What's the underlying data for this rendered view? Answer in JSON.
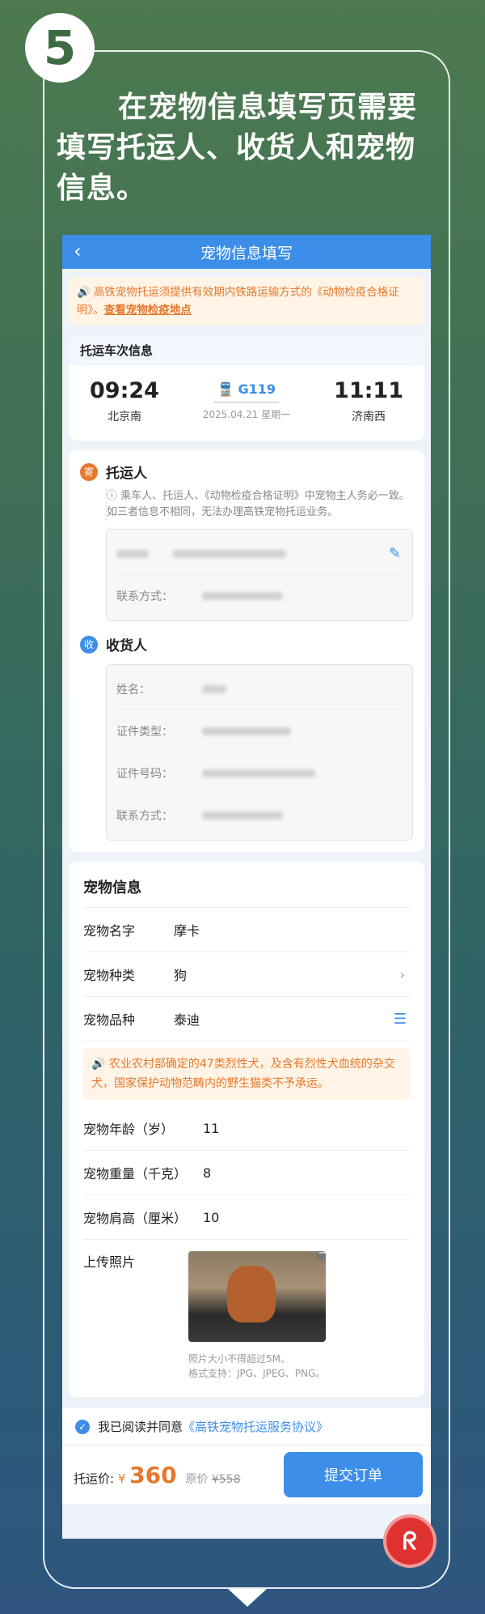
{
  "step": {
    "number": "5"
  },
  "headline": "在宠物信息填写页需要填写托运人、收货人和宠物信息。",
  "navbar": {
    "title": "宠物信息填写",
    "back_icon": "chevron-left-icon"
  },
  "notice": {
    "text": "高铁宠物托运须提供有效期内铁路运输方式的《动物检疫合格证明》。",
    "link": "查看宠物检疫地点"
  },
  "train": {
    "section_title": "托运车次信息",
    "depart_time": "09:24",
    "depart_station": "北京南",
    "train_no": "G119",
    "date": "2025.04.21 星期一",
    "arrive_time": "11:11",
    "arrive_station": "济南西"
  },
  "shipper": {
    "badge": "寄",
    "title": "托运人",
    "hint": "乘车人、托运人、《动物检疫合格证明》中宠物主人务必一致。如三者信息不相同，无法办理高铁宠物托运业务。",
    "contact_label": "联系方式："
  },
  "receiver": {
    "badge": "收",
    "title": "收货人",
    "rows": [
      {
        "label": "姓名："
      },
      {
        "label": "证件类型："
      },
      {
        "label": "证件号码："
      },
      {
        "label": "联系方式："
      }
    ]
  },
  "pet": {
    "title": "宠物信息",
    "name_label": "宠物名字",
    "name_value": "摩卡",
    "kind_label": "宠物种类",
    "kind_value": "狗",
    "breed_label": "宠物品种",
    "breed_value": "泰迪",
    "warning": "农业农村部确定的47类烈性犬，及含有烈性犬血统的杂交犬，国家保护动物范畴内的野生猫类不予承运。",
    "age_label": "宠物年龄（岁）",
    "age_value": "11",
    "weight_label": "宠物重量（千克）",
    "weight_value": "8",
    "height_label": "宠物肩高（厘米）",
    "height_value": "10",
    "upload_label": "上传照片",
    "photo_note_1": "照片大小不得超过5M。",
    "photo_note_2": "格式支持：JPG、JPEG、PNG。"
  },
  "agreement": {
    "prefix": "我已阅读并同意",
    "link": "《高铁宠物托运服务协议》"
  },
  "footer": {
    "price_label": "托运价:",
    "currency": "¥",
    "price": "360",
    "orig_label": "原价",
    "orig_price": "¥558",
    "submit_label": "提交订单"
  },
  "logo_text": "ᖇ",
  "colors": {
    "accent": "#3c8ee8",
    "warning": "#e5782c",
    "badge": "#e03131"
  }
}
